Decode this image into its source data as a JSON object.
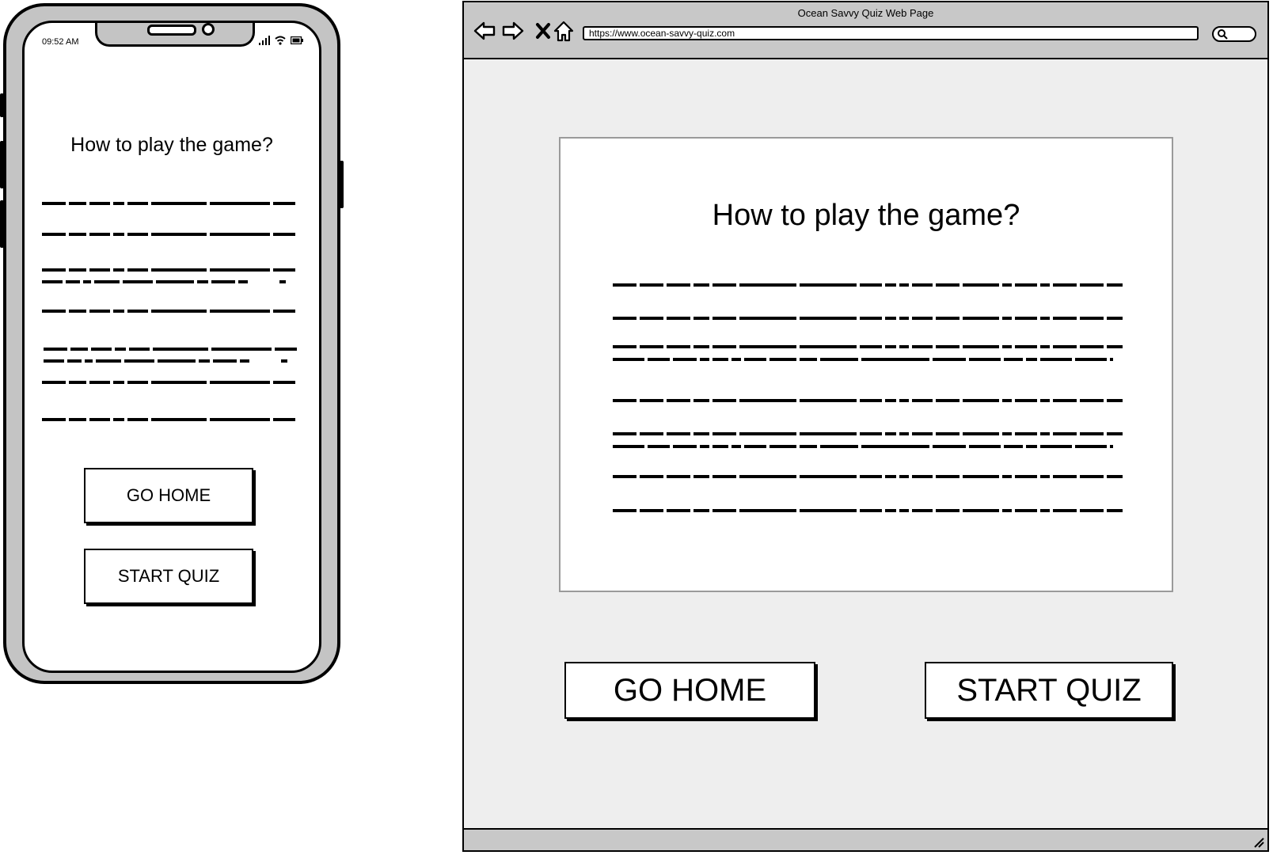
{
  "mobile": {
    "status_bar": {
      "time": "09:52 AM"
    },
    "heading": "How to play the game?",
    "buttons": {
      "go_home": "GO HOME",
      "start_quiz": "START QUIZ"
    }
  },
  "desktop": {
    "window_title": "Ocean Savvy Quiz Web Page",
    "url": "https://www.ocean-savvy-quiz.com",
    "heading": "How to play the game?",
    "buttons": {
      "go_home": "GO HOME",
      "start_quiz": "START QUIZ"
    }
  },
  "icons": {
    "nav": [
      "back-arrow-icon",
      "forward-arrow-icon",
      "close-icon",
      "home-icon"
    ],
    "search": "search-icon",
    "status": [
      "signal-icon",
      "wifi-icon",
      "battery-icon"
    ]
  }
}
